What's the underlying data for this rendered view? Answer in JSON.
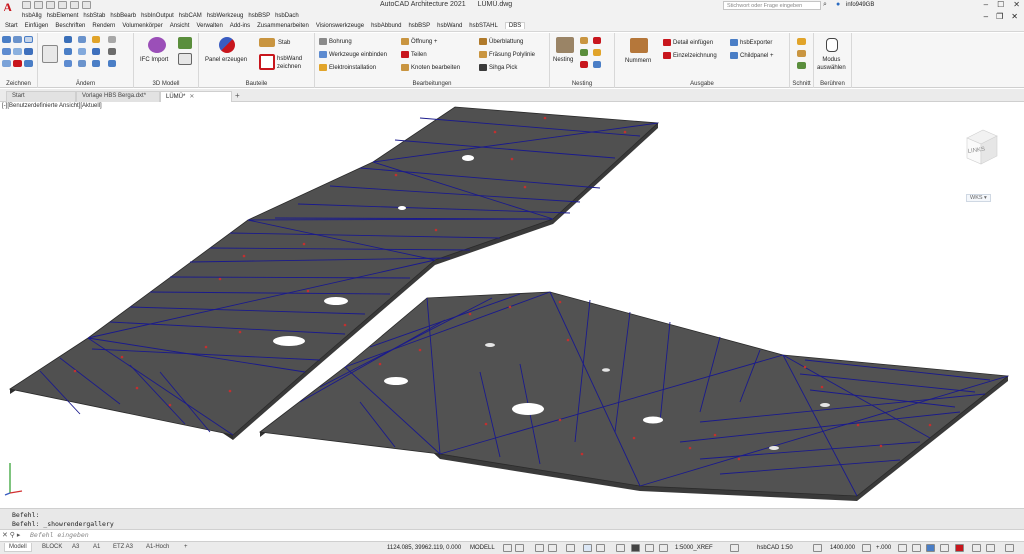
{
  "app": {
    "title": "AutoCAD Architecture 2021",
    "filename": "LÜMÜ.dwg",
    "search_placeholder": "Stichwort oder Frage eingeben",
    "user": "info949GB",
    "logo": "A"
  },
  "plugin_menu": [
    "hsbAllg",
    "hsbElement",
    "hsbStab",
    "hsbBearb",
    "hsbInOutput",
    "hsbCAM",
    "hsbWerkzeug",
    "hsbBSP",
    "hsbDach"
  ],
  "ribbon_tabs": [
    "Start",
    "Einfügen",
    "Beschriften",
    "Rendern",
    "Volumenkörper",
    "Ansicht",
    "Verwalten",
    "Add-ins",
    "Zusammenarbeiten",
    "Visionswerkzeuge",
    "hsbAbbund",
    "hsbBSP",
    "hsbWand",
    "hsbSTAHL",
    "DBS"
  ],
  "ribbon": {
    "zeichnen": "Zeichnen",
    "aendern": "Ändern",
    "modell3d": "3D Modell",
    "ifc_import": "IFC Import",
    "bauteile": "Bauteile",
    "panel_erzeugen": "Panel erzeugen",
    "stab": "Stab",
    "hsbwand_zeichnen_1": "hsbWand",
    "hsbwand_zeichnen_2": "zeichnen",
    "bearbeitungen": "Bearbeitungen",
    "bohrung": "Bohrung",
    "werkzeuge_einbinden": "Werkzeuge einbinden",
    "elektroinstallation": "Elektroinstallation",
    "oeffnung": "Öffnung +",
    "teilen": "Teilen",
    "knoten_bearbeiten": "Knoten bearbeiten",
    "ueberblattung": "Überblattung",
    "fraesung_polylinie": "Fräsung Polylinie",
    "sihga_pick": "Sihga Pick",
    "nesting_label": "Nesting",
    "nesting_panel": "Nesting",
    "nummern": "Nummern",
    "detail_einfuegen": "Detail einfügen",
    "einzelzeichnung": "Einzelzeichnung",
    "hsbexporter": "hsbExporter",
    "childpanel": "Childpanel +",
    "ausgabe": "Ausgabe",
    "schnitt": "Schnitt",
    "modus_1": "Modus",
    "modus_2": "auswählen",
    "beruehren": "Berühren"
  },
  "file_tabs": [
    "Start",
    "Vorlage HBS Berga.dxt*",
    "LÜMÜ*"
  ],
  "viewport_label": "[-][Benutzerdefinierte Ansicht][Aktuell]",
  "viewcube_label": "LINKS",
  "wks_label": "WKS",
  "command_history": [
    "Befehl:",
    "Befehl: _showrendergallery"
  ],
  "command_placeholder": "Befehl eingeben",
  "layout_tabs": [
    "Modell",
    "BLOCK",
    "A3",
    "A1",
    "ETZ A3",
    "A1-Hoch"
  ],
  "status": {
    "coords": "1124.085, 39962.119, 0.000",
    "mode": "MODELL",
    "scale": "1:5000_XREF",
    "hsbcad": "hsbCAD 1:50",
    "value1": "1400.000",
    "value2": "+.000"
  },
  "colors": {
    "panel_fill": "#505050",
    "panel_edge": "#2a2a2a",
    "joint_line": "#1a1a8c",
    "marker": "#c23030",
    "logo_red": "#c8161d"
  }
}
